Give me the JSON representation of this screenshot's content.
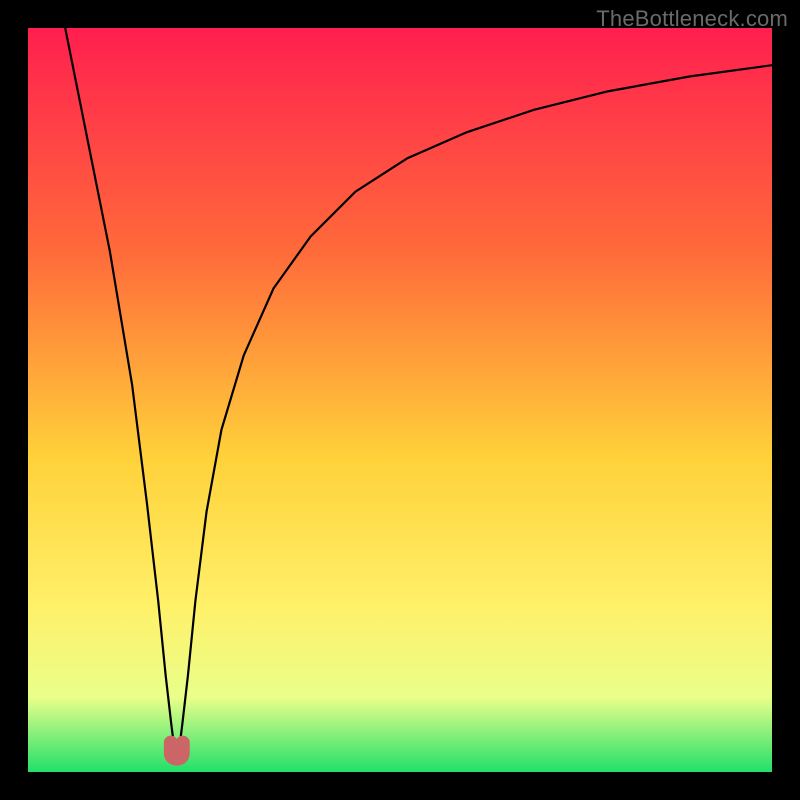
{
  "watermark": "TheBottleneck.com",
  "colors": {
    "frame": "#000000",
    "curve": "#000000",
    "marker_fill": "#cc6666",
    "marker_stroke": "#b05050",
    "grad_top": "#ff1f4f",
    "grad_mid1": "#ff6a3a",
    "grad_mid2": "#ffd23a",
    "grad_mid3": "#fff16a",
    "grad_mid4": "#e9ff8a",
    "grad_bottom": "#21e06a"
  },
  "chart_data": {
    "type": "line",
    "title": "",
    "xlabel": "",
    "ylabel": "",
    "xlim": [
      0,
      100
    ],
    "ylim": [
      0,
      100
    ],
    "x_at_min": 20,
    "series": [
      {
        "name": "bottleneck-curve",
        "x": [
          5,
          8,
          11,
          14,
          16,
          17.5,
          18.5,
          19.25,
          19.75,
          20,
          20.25,
          20.75,
          21.5,
          22.5,
          24,
          26,
          29,
          33,
          38,
          44,
          51,
          59,
          68,
          78,
          89,
          100
        ],
        "y": [
          100,
          85,
          70,
          52,
          36,
          23,
          13,
          6.5,
          2.5,
          1.2,
          2.5,
          6.5,
          13,
          23,
          35,
          46,
          56,
          65,
          72,
          78,
          82.5,
          86,
          89,
          91.5,
          93.5,
          95
        ]
      }
    ],
    "marker": {
      "name": "optimal-point",
      "shape": "u",
      "x_range": [
        19.2,
        20.8
      ],
      "y": 1.8
    }
  }
}
